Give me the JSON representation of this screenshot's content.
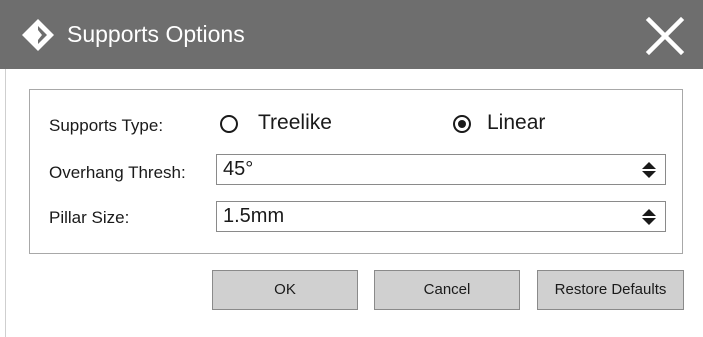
{
  "dialog": {
    "title": "Supports Options",
    "title_icon": "diamond-logo-icon",
    "close_icon": "close-icon"
  },
  "form": {
    "supports_type_label": "Supports Type:",
    "options": [
      {
        "label": "Treelike",
        "selected": false
      },
      {
        "label": "Linear",
        "selected": true
      }
    ],
    "overhang_label": "Overhang Thresh:",
    "overhang_value": "45°",
    "pillar_label": "Pillar Size:",
    "pillar_value": "1.5mm"
  },
  "buttons": {
    "ok": "OK",
    "cancel": "Cancel",
    "restore": "Restore Defaults"
  },
  "colors": {
    "titlebar": "#6e6e6e",
    "button_bg": "#d0d0d0",
    "border": "#8a8a8a"
  }
}
